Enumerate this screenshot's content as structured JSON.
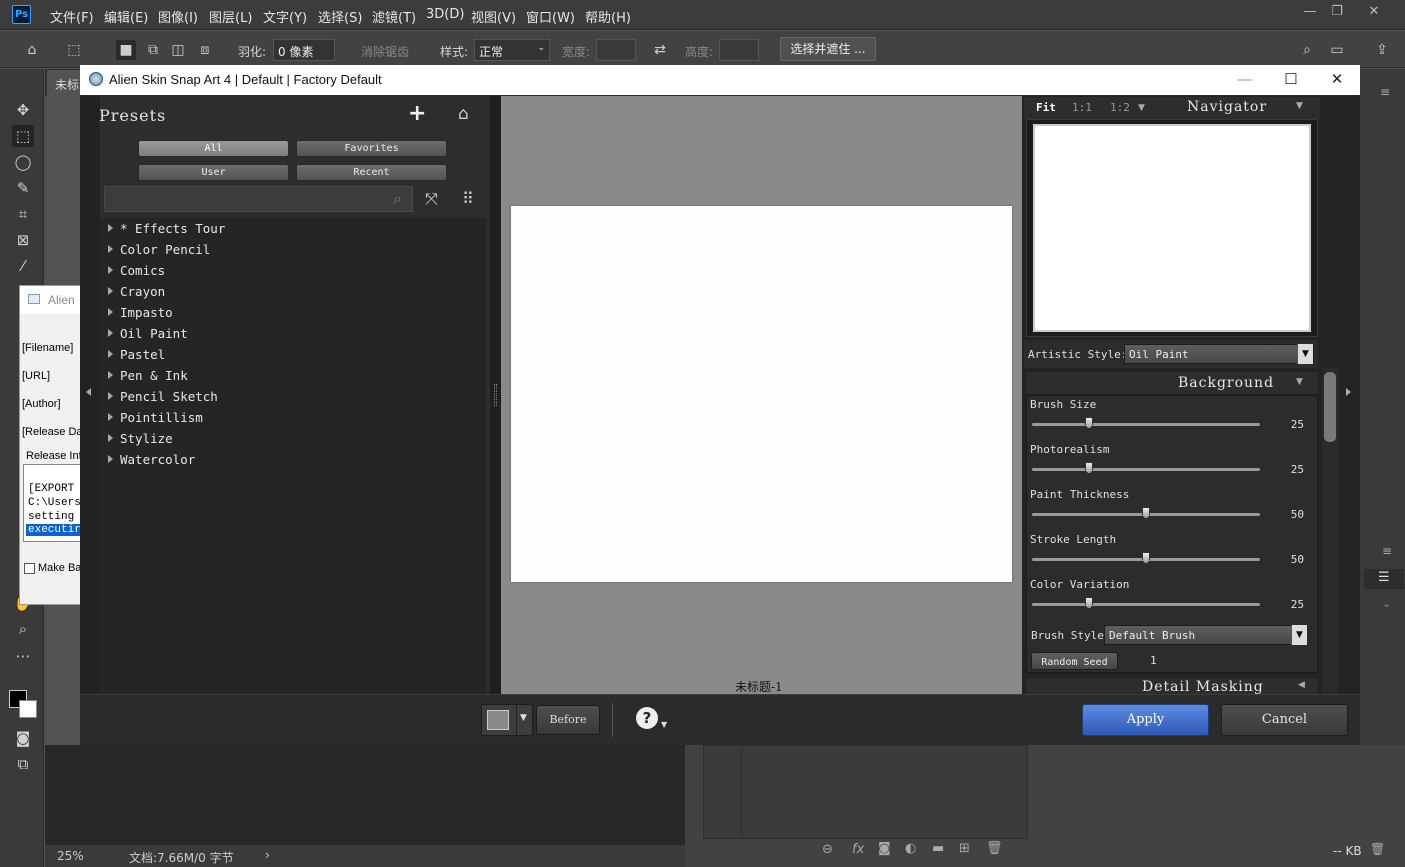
{
  "menubar": {
    "logo": "Ps",
    "items": [
      "文件(F)",
      "编辑(E)",
      "图像(I)",
      "图层(L)",
      "文字(Y)",
      "选择(S)",
      "滤镜(T)",
      "3D(D)",
      "视图(V)",
      "窗口(W)",
      "帮助(H)"
    ]
  },
  "options": {
    "feather_label": "羽化:",
    "feather_value": "0 像素",
    "antialias_label": "消除锯齿",
    "style_label": "样式:",
    "style_value": "正常",
    "width_label": "宽度:",
    "height_label": "高度:",
    "select_mask": "选择并遮住 ..."
  },
  "document": {
    "tab_label": "未标",
    "zoom": "25%",
    "doc_info": "文档:7.66M/0 字节",
    "kb": "-- KB"
  },
  "bg_dialog": {
    "title": "Alien",
    "fields": [
      "[Filename]",
      "[URL]",
      "[Author]",
      "[Release Da"
    ],
    "release_info": "Release Inf",
    "log_lines": [
      "[EXPORT",
      "C:\\Users",
      "setting",
      "executir"
    ],
    "make_backup": "Make Ba"
  },
  "plugin": {
    "title": "Alien Skin Snap Art 4 | Default | Factory Default",
    "presets": {
      "title": "Presets",
      "filters": {
        "all": "All",
        "favorites": "Favorites",
        "user": "User",
        "recent": "Recent"
      },
      "items": [
        "* Effects Tour",
        "Color Pencil",
        "Comics",
        "Crayon",
        "Impasto",
        "Oil Paint",
        "Pastel",
        "Pen & Ink",
        "Pencil Sketch",
        "Pointillism",
        "Stylize",
        "Watercolor"
      ]
    },
    "preview": {
      "doc_name": "未标题-1"
    },
    "navigator": {
      "zoom_fit": "Fit",
      "zoom_1_1": "1:1",
      "zoom_1_2": "1:2",
      "title": "Navigator"
    },
    "artistic_style": {
      "label": "Artistic Style:",
      "value": "Oil Paint"
    },
    "background": {
      "title": "Background",
      "sliders": [
        {
          "label": "Brush Size",
          "value": "25",
          "fraction": 0.25
        },
        {
          "label": "Photorealism",
          "value": "25",
          "fraction": 0.25
        },
        {
          "label": "Paint Thickness",
          "value": "50",
          "fraction": 0.5
        },
        {
          "label": "Stroke Length",
          "value": "50",
          "fraction": 0.5
        },
        {
          "label": "Color Variation",
          "value": "25",
          "fraction": 0.25
        }
      ],
      "brush_style_label": "Brush Style",
      "brush_style_value": "Default Brush",
      "random_seed_label": "Random Seed",
      "random_seed_value": "1"
    },
    "detail_masking": "Detail Masking",
    "buttons": {
      "before": "Before",
      "apply": "Apply",
      "cancel": "Cancel",
      "help": "?"
    }
  }
}
